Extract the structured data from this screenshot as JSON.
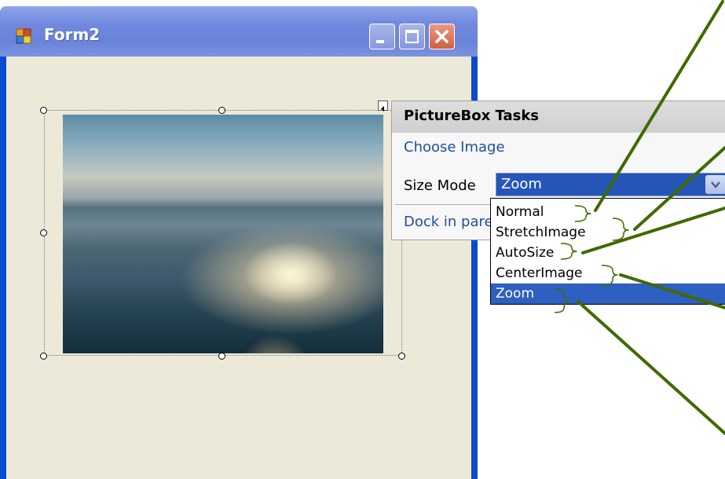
{
  "window": {
    "title": "Form2"
  },
  "smart_tag": {
    "title": "PictureBox Tasks",
    "choose_image": "Choose Image",
    "size_mode_label": "Size Mode",
    "size_mode_value": "Zoom",
    "dock_link": "Dock in pare"
  },
  "size_mode_options": [
    {
      "label": "Normal",
      "selected": false
    },
    {
      "label": "StretchImage",
      "selected": false
    },
    {
      "label": "AutoSize",
      "selected": false
    },
    {
      "label": "CenterImage",
      "selected": false
    },
    {
      "label": "Zoom",
      "selected": true
    }
  ],
  "colors": {
    "annotation": "#3f6a00",
    "selection": "#2f5fc0",
    "link": "#1f4f9a"
  },
  "icons": [
    "app-icon",
    "minimize-icon",
    "maximize-icon",
    "close-icon",
    "smart-tag-glyph-icon",
    "dropdown-arrow-icon"
  ]
}
